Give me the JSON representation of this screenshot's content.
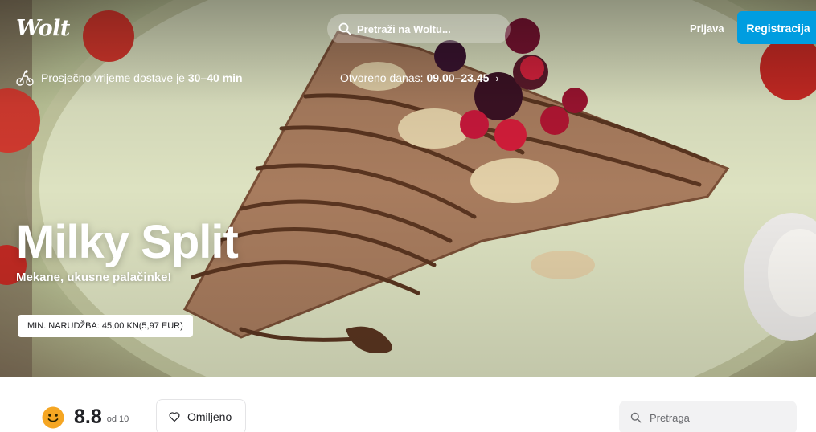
{
  "header": {
    "logo_text": "Wolt",
    "search_label": "Pretraži na Woltu...",
    "login_label": "Prijava",
    "register_label": "Registracija",
    "register_color": "#009de0"
  },
  "info": {
    "delivery_prefix": "Prosječno vrijeme dostave je",
    "delivery_time": "30–40 min",
    "hours_prefix": "Otvoreno danas:",
    "hours_value": "09.00–23.45",
    "hours_chevron": "›"
  },
  "venue": {
    "name": "Milky Split",
    "tagline": "Mekane, ukusne palačinke!",
    "min_order": "MIN. NARUDŽBA: 45,00 KN(5,97 EUR)"
  },
  "bar": {
    "rating_score": "8.8",
    "rating_of": "od 10",
    "favorite_label": "Omiljeno",
    "search_placeholder": "Pretraga"
  },
  "icons": {
    "search": "search-icon",
    "courier": "bike-courier-icon",
    "smile": "smile-icon",
    "heart": "heart-icon"
  }
}
